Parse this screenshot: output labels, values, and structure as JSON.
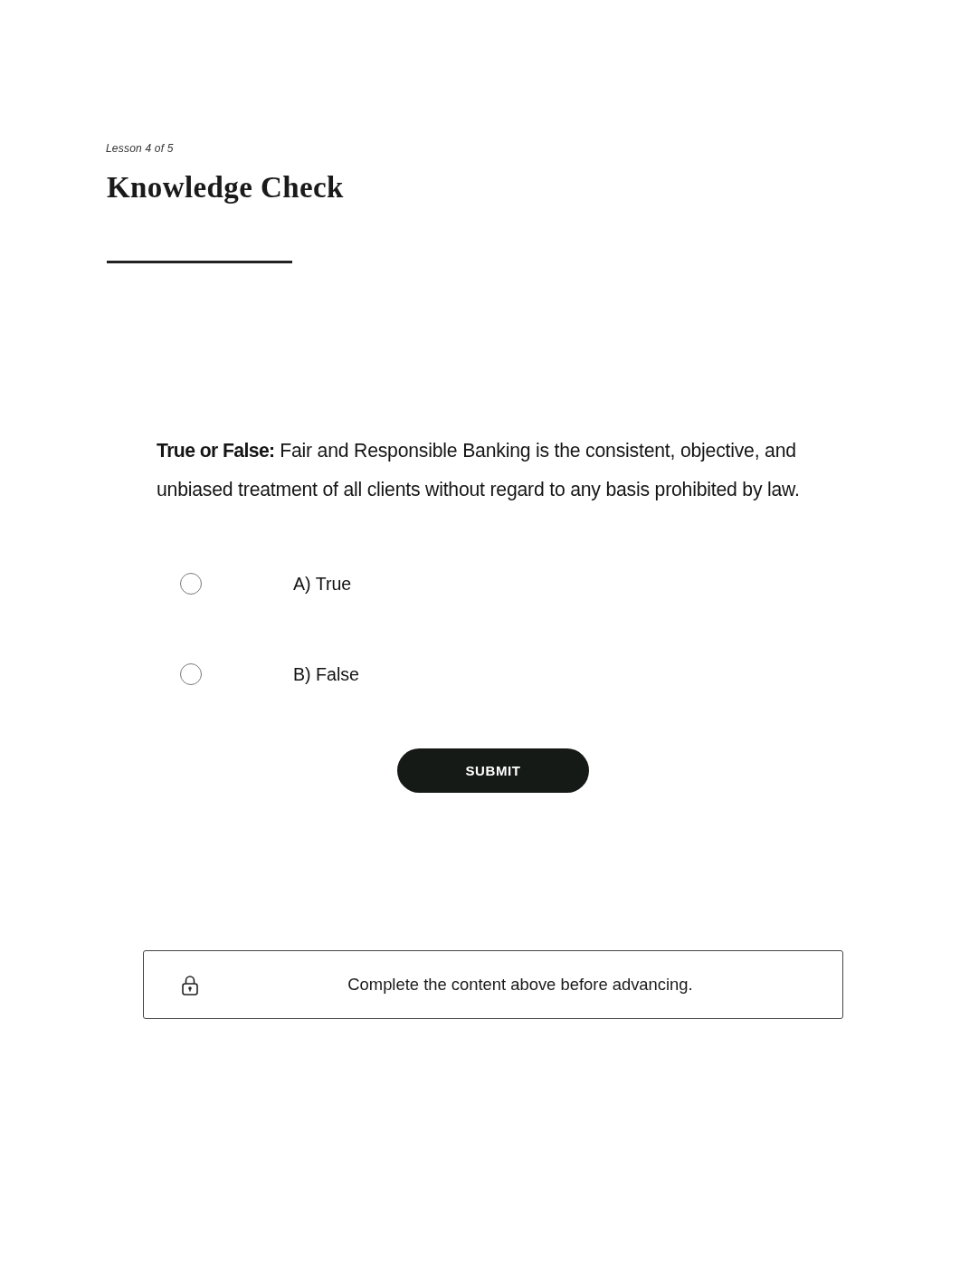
{
  "lesson": {
    "progress": "Lesson 4 of 5",
    "title": "Knowledge Check"
  },
  "question": {
    "prompt": "**True or False:** Fair and Responsible Banking is the consistent, objective, and unbiased treatment of all clients without regard to any basis prohibited by law.",
    "options": [
      {
        "label": "A) True",
        "selected": false
      },
      {
        "label": "B) False",
        "selected": false
      }
    ],
    "submit": "SUBMIT"
  },
  "notice": {
    "text": "Complete the content above before advancing."
  }
}
